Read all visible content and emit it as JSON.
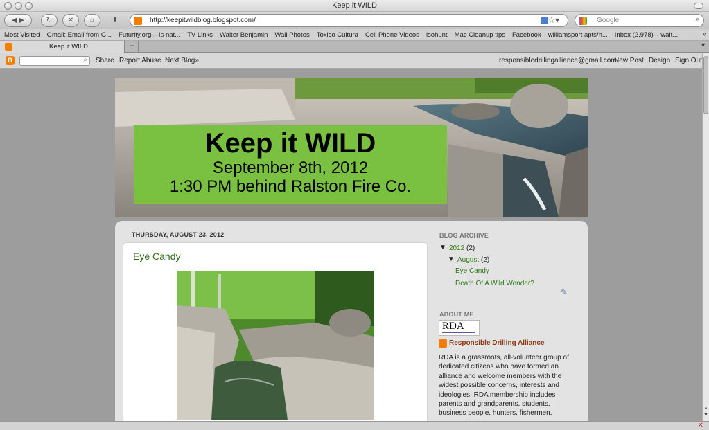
{
  "window": {
    "title": "Keep it WILD"
  },
  "toolbar": {
    "url": "http://keepitwildblog.blogspot.com/",
    "search_placeholder": "Google",
    "back_icon": "back-arrow-icon",
    "forward_icon": "forward-arrow-icon"
  },
  "bookmarks": [
    "Most Visited",
    "Gmail: Email from G...",
    "Futurity.org – Is nat...",
    "TV Links",
    "Walter Benjamin",
    "Wall Photos",
    "Toxico Cultura",
    "Cell Phone Videos",
    "isohunt",
    "Mac Cleanup tips",
    "Facebook",
    "williamsport apts/h...",
    "Inbox (2,978) – wait..."
  ],
  "tab": {
    "label": "Keep it WILD"
  },
  "blogger_nav": {
    "share": "Share",
    "report": "Report Abuse",
    "next": "Next Blog»",
    "email": "responsibledrillingalliance@gmail.com",
    "new_post": "New Post",
    "design": "Design",
    "sign_out": "Sign Out"
  },
  "banner": {
    "title": "Keep it WILD",
    "date": "September 8th, 2012",
    "time": "1:30 PM behind Ralston Fire Co."
  },
  "post": {
    "date": "THURSDAY, AUGUST 23, 2012",
    "title": "Eye Candy"
  },
  "sidebar": {
    "archive_heading": "BLOG ARCHIVE",
    "year": "2012",
    "year_count": "(2)",
    "month": "August",
    "month_count": "(2)",
    "posts": [
      "Eye Candy",
      "Death Of A Wild Wonder?"
    ],
    "about_heading": "ABOUT ME",
    "logo_text": "RDA",
    "profile_name": "Responsible Drilling Alliance",
    "about_text": "RDA is a grassroots, all-volunteer group of dedicated citizens who have formed an alliance and welcome members with the widest possible concerns, interests and ideologies. RDA membership includes parents and grandparents, students, business people, hunters, fishermen,"
  },
  "colors": {
    "banner_green": "#7ac142",
    "link_green": "#2f7a14",
    "blogger_orange": "#f57d00"
  }
}
